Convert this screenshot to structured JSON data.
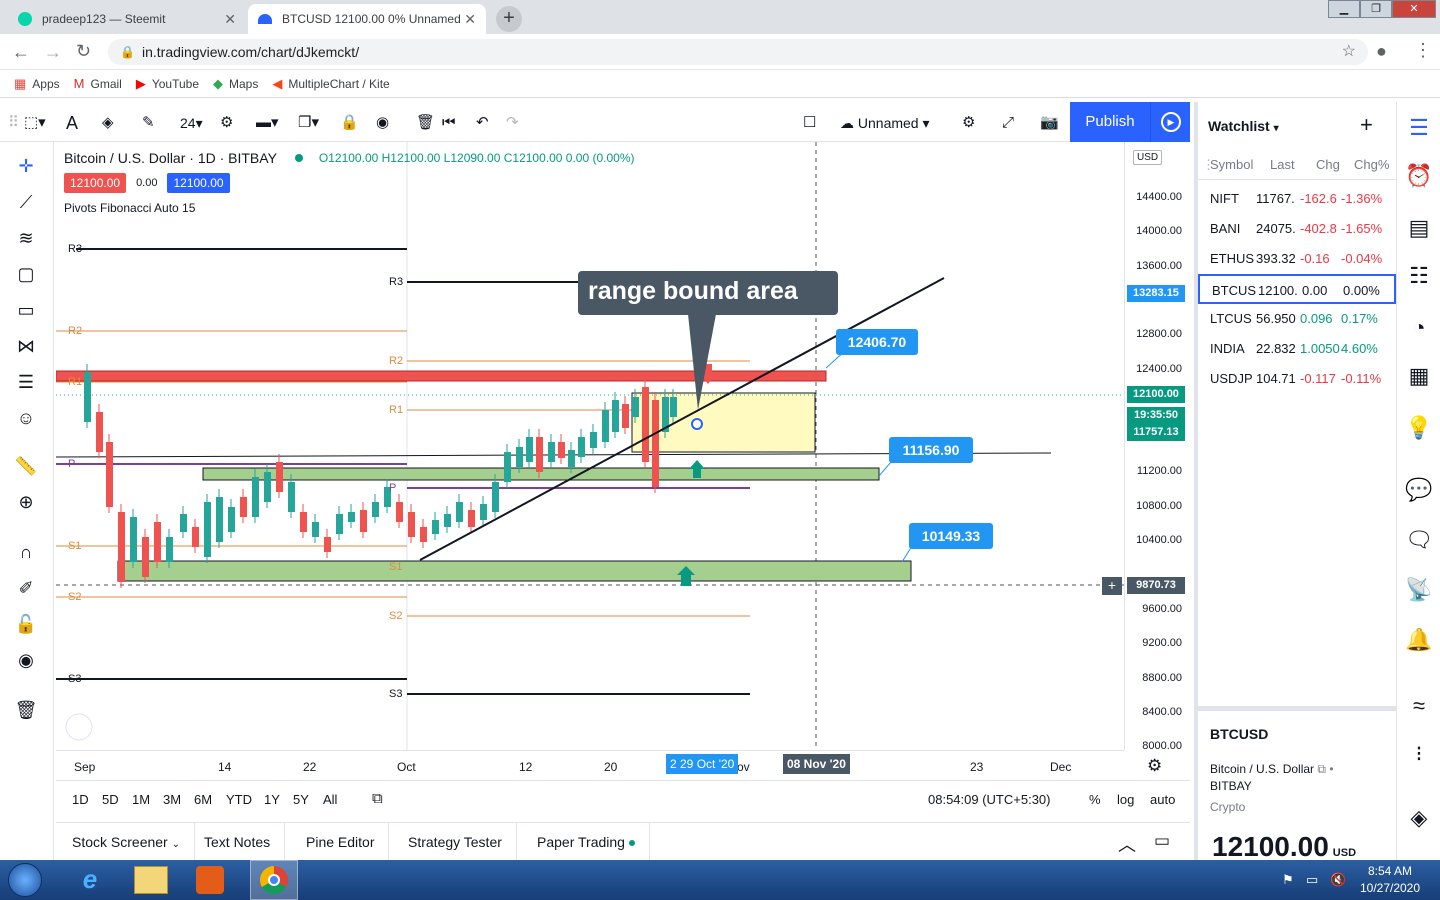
{
  "browser": {
    "tabs": [
      {
        "title": "pradeep123 — Steemit",
        "close": "✕"
      },
      {
        "title": "BTCUSD 12100.00 0% Unnamed",
        "close": "✕"
      }
    ],
    "new_tab": "+",
    "url": "in.tradingview.com/chart/dJkemckt/",
    "bookmarks": [
      {
        "icon": "apps-icon",
        "label": "Apps"
      },
      {
        "icon": "gmail-icon",
        "label": "Gmail"
      },
      {
        "icon": "youtube-icon",
        "label": "YouTube"
      },
      {
        "icon": "maps-icon",
        "label": "Maps"
      },
      {
        "icon": "kite-icon",
        "label": "MultipleChart / Kite"
      }
    ]
  },
  "toolbar": {
    "font_size": "24",
    "layout_name": "Unnamed",
    "publish": "Publish"
  },
  "legend": {
    "symbol": "Bitcoin / U.S. Dollar · 1D · BITBAY",
    "ohlc": "O12100.00 H12100.00 L12090.00 C12100.00 0.00 (0.00%)",
    "sell": "12100.00",
    "spread": "0.00",
    "buy": "12100.00",
    "indicator": "Pivots Fibonacci Auto 15"
  },
  "annotation": {
    "text": "range bound area"
  },
  "callouts": [
    "12406.70",
    "11156.90",
    "10149.33"
  ],
  "price_axis": {
    "currency": "USD",
    "ticks": [
      "14400.00",
      "14000.00",
      "13600.00",
      "12800.00",
      "12400.00",
      "11200.00",
      "10800.00",
      "10400.00",
      "9600.00",
      "9200.00",
      "8800.00",
      "8400.00",
      "8000.00"
    ],
    "labels": {
      "top": "13283.15",
      "last": "12100.00",
      "countdown": "19:35:50",
      "low": "11757.13",
      "cross": "9870.73"
    }
  },
  "pivot_labels": [
    "R3",
    "R2",
    "R1",
    "P",
    "S1",
    "S2",
    "S3",
    "R3",
    "R2",
    "R1",
    "P",
    "S1",
    "S2",
    "S3"
  ],
  "time_axis": {
    "ticks": [
      "Sep",
      "14",
      "22",
      "Oct",
      "12",
      "20",
      "ov",
      "23",
      "Dec"
    ],
    "hl_date": "2 29 Oct '20",
    "cross_date": "08 Nov '20"
  },
  "bottom": {
    "ranges": [
      "1D",
      "5D",
      "1M",
      "3M",
      "6M",
      "YTD",
      "1Y",
      "5Y",
      "All"
    ],
    "time": "08:54:09 (UTC+5:30)",
    "pct": "%",
    "log": "log",
    "auto": "auto"
  },
  "panels": [
    "Stock Screener",
    "Text Notes",
    "Pine Editor",
    "Strategy Tester",
    "Paper Trading"
  ],
  "watchlist": {
    "title": "Watchlist",
    "columns": [
      "Symbol",
      "Last",
      "Chg",
      "Chg%"
    ],
    "rows": [
      {
        "sym": "NIFT",
        "last": "11767.",
        "chg": "-162.6",
        "pct": "-1.36%",
        "color": "#f23645"
      },
      {
        "sym": "BANI",
        "last": "24075.",
        "chg": "-402.8",
        "pct": "-1.65%",
        "color": "#f23645"
      },
      {
        "sym": "ETHUS",
        "last": "393.32",
        "chg": "-0.16",
        "pct": "-0.04%",
        "color": "#f23645"
      },
      {
        "sym": "BTCUS",
        "last": "12100.",
        "chg": "0.00",
        "pct": "0.00%",
        "color": "#131722"
      },
      {
        "sym": "LTCUS",
        "last": "56.950",
        "chg": "0.096",
        "pct": "0.17%",
        "color": "#089981"
      },
      {
        "sym": "INDIA",
        "last": "22.832",
        "chg": "1.0050",
        "pct": "4.60%",
        "color": "#089981"
      },
      {
        "sym": "USDJP",
        "last": "104.71",
        "chg": "-0.117",
        "pct": "-0.11%",
        "color": "#f23645"
      }
    ],
    "details": {
      "symbol": "BTCUSD",
      "name": "Bitcoin / U.S. Dollar",
      "exchange": "BITBAY",
      "type": "Crypto",
      "price": "12100.00",
      "currency": "USD"
    }
  },
  "taskbar": {
    "time": "8:54 AM",
    "date": "10/27/2020"
  },
  "colors": {
    "accent": "#2962ff",
    "up": "#26a69a",
    "down": "#ef5350",
    "zone_green": "#a5cf8e",
    "zone_red": "#ef5350",
    "zone_yellow": "#fffbc0"
  }
}
